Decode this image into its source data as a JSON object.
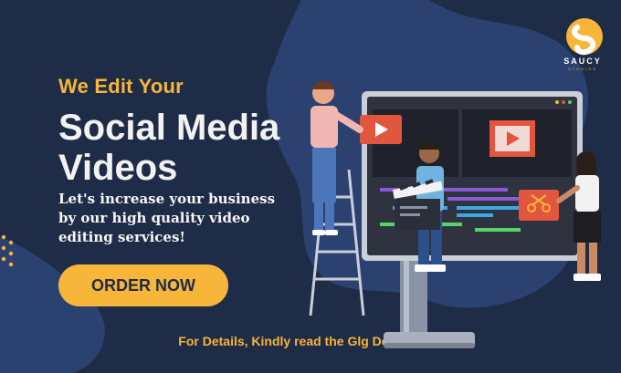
{
  "headline": {
    "line1": "We Edit Your",
    "line2a": "Social Media",
    "line2b": "Videos"
  },
  "tagline": "Let's increase your business by our high quality video editing services!",
  "cta": {
    "label": "ORDER NOW"
  },
  "footer": {
    "note": "For Details, Kindly read the Glg Description"
  },
  "logo": {
    "name": "SAUCY",
    "sub": "STUDIOS"
  },
  "colors": {
    "background": "#1f2c47",
    "blob": "#2b4270",
    "accent": "#f7b53a",
    "text": "#f2f2f2",
    "play_red": "#e2553f"
  },
  "icons": [
    "play-icon",
    "film-strip-icon",
    "clapperboard-icon",
    "scissors-icon",
    "saucy-logo-icon"
  ]
}
